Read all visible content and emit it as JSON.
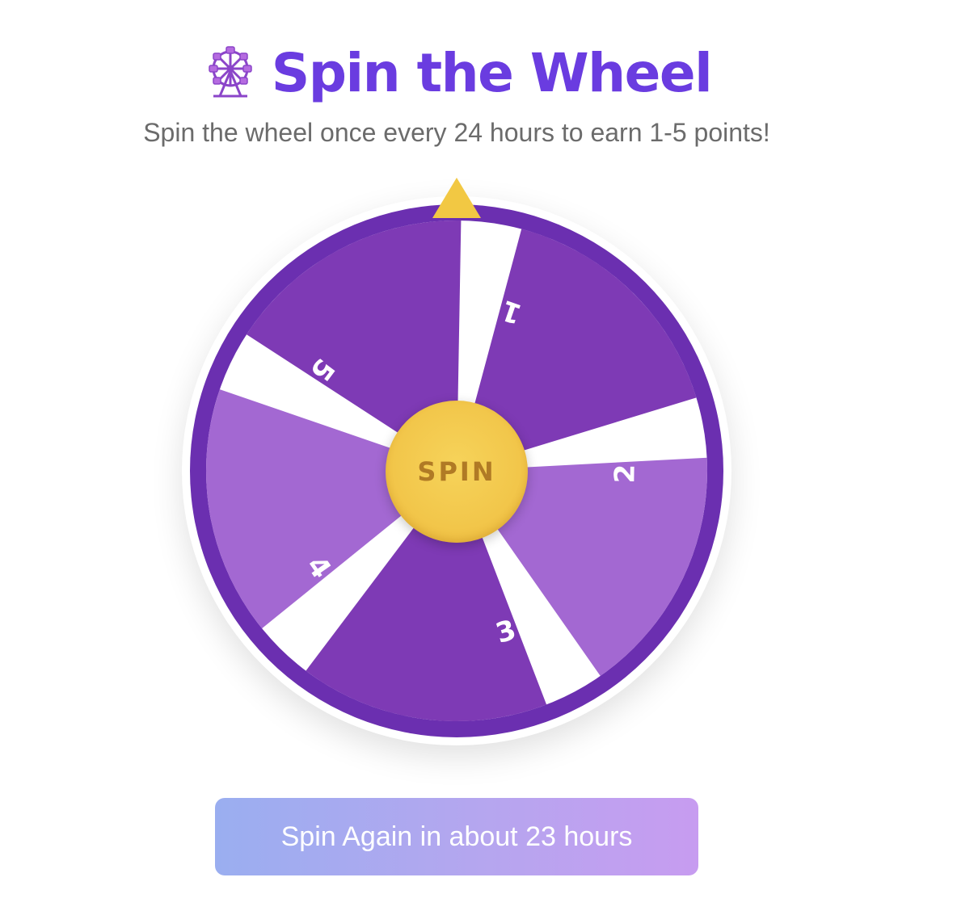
{
  "header": {
    "icon": "ferris-wheel-icon",
    "title": "Spin the Wheel"
  },
  "subtitle": "Spin the wheel once every 24 hours to earn 1-5 points!",
  "wheel": {
    "pointer_color": "#f2c843",
    "rim_color": "#6b2fb0",
    "segments": [
      {
        "label": "1",
        "color": "#7e3ab5"
      },
      {
        "label": "2",
        "color": "#a368d2"
      },
      {
        "label": "3",
        "color": "#7e3ab5"
      },
      {
        "label": "4",
        "color": "#a368d2"
      },
      {
        "label": "5",
        "color": "#7e3ab5"
      }
    ],
    "spin_label": "SPIN"
  },
  "cooldown_button": {
    "label": "Spin Again in about 23 hours"
  },
  "colors": {
    "accent": "#6a3ce0",
    "hub": "#f2c64a",
    "hub_text": "#b07a25"
  }
}
